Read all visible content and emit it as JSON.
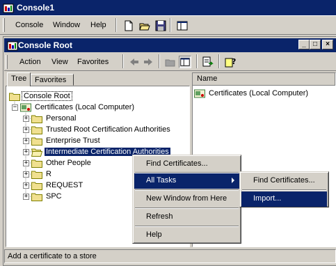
{
  "app": {
    "title": "Console1",
    "titlebar_color": "#0a246a"
  },
  "menubar": {
    "items": [
      "Console",
      "Window",
      "Help"
    ]
  },
  "toolbar": {
    "icons": [
      "new-icon",
      "open-icon",
      "save-icon",
      "new-window-icon"
    ]
  },
  "inner_window": {
    "title": "Console Root",
    "buttons": [
      "minimize",
      "restore",
      "close"
    ]
  },
  "inner_menu": {
    "items": [
      "Action",
      "View",
      "Favorites"
    ]
  },
  "inner_toolbar": {
    "icons": [
      "back-icon",
      "forward-icon",
      "up-icon",
      "show-hide-tree-icon",
      "export-list-icon",
      "help-icon"
    ]
  },
  "tabs": [
    "Tree",
    "Favorites"
  ],
  "tree": {
    "root": "Console Root",
    "certs": "Certificates (Local Computer)",
    "children": [
      "Personal",
      "Trusted Root Certification Authorities",
      "Enterprise Trust",
      "Intermediate Certification Authorities",
      "Other People",
      "R",
      "REQUEST",
      "SPC"
    ]
  },
  "list": {
    "column": "Name",
    "items": [
      "Certificates (Local Computer)"
    ]
  },
  "context_menu": {
    "items": [
      "Find Certificates...",
      "All Tasks",
      "New Window from Here",
      "Refresh",
      "Help"
    ]
  },
  "submenu": {
    "items": [
      "Find Certificates...",
      "Import..."
    ]
  },
  "status": "Add a certificate to a store"
}
